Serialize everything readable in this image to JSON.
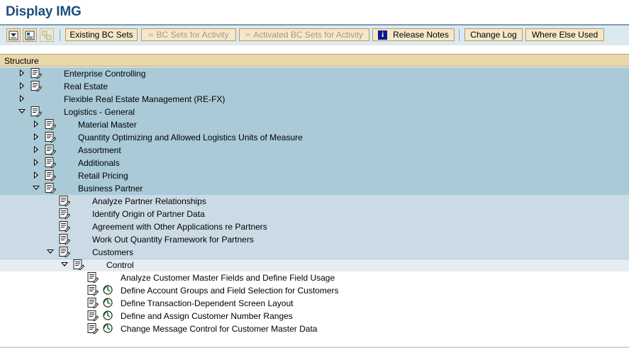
{
  "title": "Display IMG",
  "toolbar": {
    "existing_bc_sets": "Existing BC Sets",
    "bc_sets_for_activity": "BC Sets for Activity",
    "activated_bc_sets_for_activity": "Activated BC Sets for Activity",
    "release_notes": "Release Notes",
    "change_log": "Change Log",
    "where_else_used": "Where Else Used"
  },
  "tree": {
    "header": "Structure",
    "rows": [
      {
        "label": "Enterprise Controlling",
        "level": 0,
        "toggle": "closed",
        "icon": "document-icon"
      },
      {
        "label": "Real Estate",
        "level": 0,
        "toggle": "closed",
        "icon": "document-icon"
      },
      {
        "label": "Flexible Real Estate Management (RE-FX)",
        "level": 0,
        "toggle": "closed",
        "icon": "none"
      },
      {
        "label": "Logistics - General",
        "level": 0,
        "toggle": "open",
        "icon": "document-icon"
      },
      {
        "label": "Material Master",
        "level": 1,
        "toggle": "closed",
        "icon": "document-icon"
      },
      {
        "label": "Quantity Optimizing and Allowed Logistics Units of Measure",
        "level": 1,
        "toggle": "closed",
        "icon": "document-icon"
      },
      {
        "label": "Assortment",
        "level": 1,
        "toggle": "closed",
        "icon": "document-icon"
      },
      {
        "label": "Additionals",
        "level": 1,
        "toggle": "closed",
        "icon": "document-icon"
      },
      {
        "label": "Retail Pricing",
        "level": 1,
        "toggle": "closed",
        "icon": "document-icon"
      },
      {
        "label": "Business Partner",
        "level": 1,
        "toggle": "open",
        "icon": "document-icon"
      },
      {
        "label": "Analyze Partner Relationships",
        "level": 2,
        "toggle": "none",
        "icon": "document-icon"
      },
      {
        "label": "Identify Origin of Partner Data",
        "level": 2,
        "toggle": "none",
        "icon": "document-icon"
      },
      {
        "label": "Agreement with Other Applications re Partners",
        "level": 2,
        "toggle": "none",
        "icon": "document-icon"
      },
      {
        "label": "Work Out Quantity Framework for Partners",
        "level": 2,
        "toggle": "none",
        "icon": "document-icon"
      },
      {
        "label": "Customers",
        "level": 2,
        "toggle": "open",
        "icon": "document-icon"
      },
      {
        "label": "Control",
        "level": 3,
        "toggle": "open",
        "icon": "document-icon"
      },
      {
        "label": "Analyze Customer Master Fields and Define Field Usage",
        "level": 4,
        "toggle": "none",
        "icon": "document-icon"
      },
      {
        "label": "Define Account Groups and Field Selection for Customers",
        "level": 4,
        "toggle": "none",
        "icon": "document-clock-icon"
      },
      {
        "label": "Define Transaction-Dependent Screen Layout",
        "level": 4,
        "toggle": "none",
        "icon": "document-clock-icon"
      },
      {
        "label": "Define and Assign Customer Number Ranges",
        "level": 4,
        "toggle": "none",
        "icon": "document-clock-icon"
      },
      {
        "label": "Change Message Control for Customer Master Data",
        "level": 4,
        "toggle": "none",
        "icon": "document-clock-icon"
      }
    ]
  }
}
